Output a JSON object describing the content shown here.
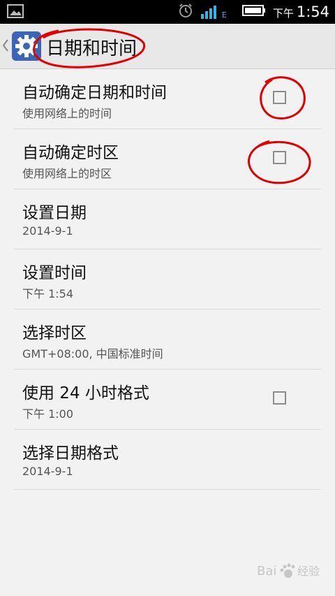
{
  "status_bar": {
    "time_ampm": "下午",
    "time": "1:54",
    "icons": [
      "image-icon",
      "alarm-icon",
      "signal-icon",
      "battery-icon"
    ],
    "network_label": "E"
  },
  "action_bar": {
    "title": "日期和时间",
    "icon": "settings-gear-icon"
  },
  "settings": [
    {
      "label": "自动确定日期和时间",
      "sub": "使用网络上的时间",
      "checkbox": true,
      "checked": false
    },
    {
      "label": "自动确定时区",
      "sub": "使用网络上的时区",
      "checkbox": true,
      "checked": false
    },
    {
      "label": "设置日期",
      "sub": "2014-9-1",
      "checkbox": false
    },
    {
      "label": "设置时间",
      "sub": "下午 1:54",
      "checkbox": false
    },
    {
      "label": "选择时区",
      "sub": "GMT+08:00, 中国标准时间",
      "checkbox": false
    },
    {
      "label": "使用 24 小时格式",
      "sub": "下午 1:00",
      "checkbox": true,
      "checked": false
    },
    {
      "label": "选择日期格式",
      "sub": "2014-9-1",
      "checkbox": false
    }
  ],
  "colors": {
    "annotation": "#e00000",
    "status_bar_bg": "#000000",
    "signal_blue": "#33b5e5",
    "gear_icon_bg": "#3a66b8"
  }
}
